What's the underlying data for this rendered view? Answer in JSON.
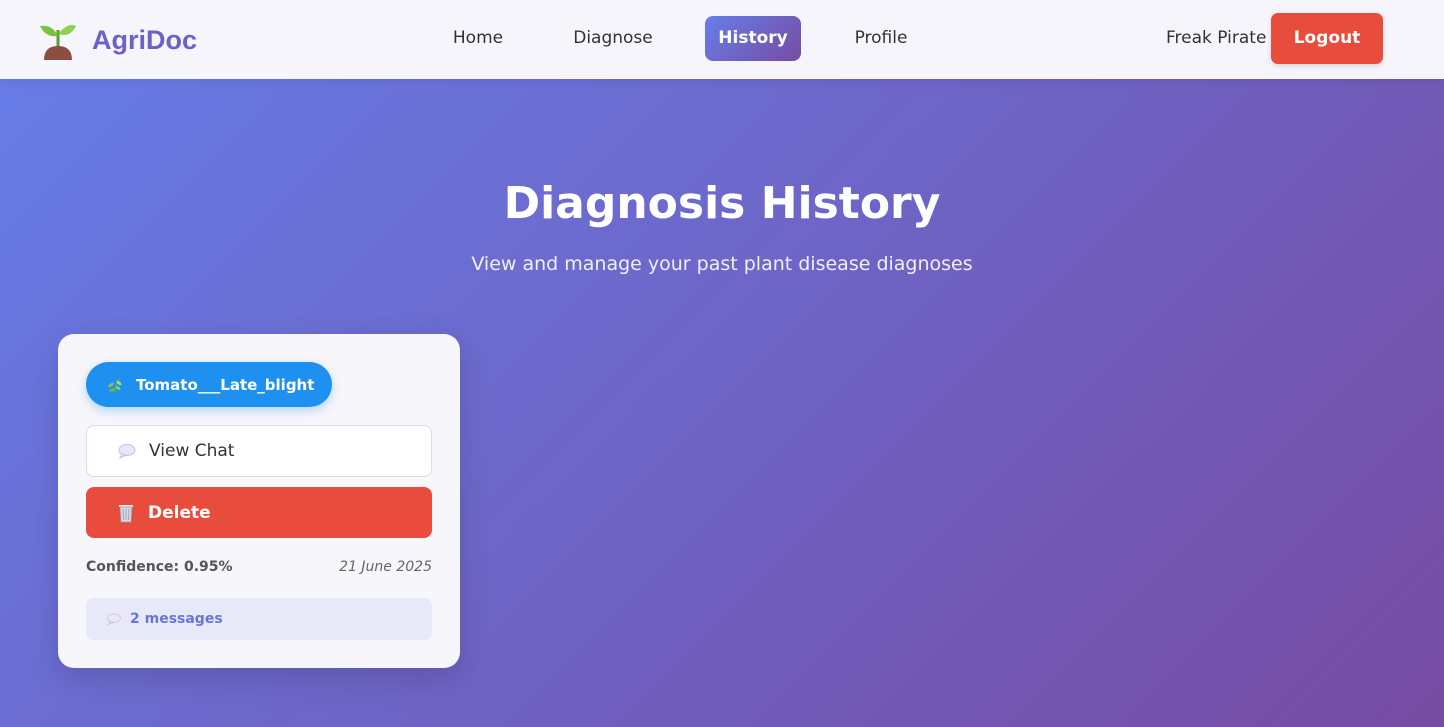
{
  "app": {
    "name": "AgriDoc",
    "logo_icon": "seedling-icon"
  },
  "nav": {
    "items": [
      {
        "label": "Home",
        "active": false
      },
      {
        "label": "Diagnose",
        "active": false
      },
      {
        "label": "History",
        "active": true
      },
      {
        "label": "Profile",
        "active": false
      }
    ],
    "username": "Freak Pirate",
    "logout_label": "Logout"
  },
  "hero": {
    "title": "Diagnosis History",
    "subtitle": "View and manage your past plant disease diagnoses"
  },
  "diagnoses": [
    {
      "disease": "Tomato___Late_blight",
      "disease_icon": "herb-icon",
      "view_chat_label": "View Chat",
      "view_chat_icon": "speech-bubble-icon",
      "delete_label": "Delete",
      "delete_icon": "wastebasket-icon",
      "confidence_text": "Confidence: 0.95%",
      "date": "21 June 2025",
      "messages_text": "2 messages",
      "messages_icon": "speech-bubble-icon"
    }
  ],
  "colors": {
    "primary_gradient_start": "#667eea",
    "primary_gradient_end": "#764ba2",
    "logout": "#e74c3c",
    "delete": "#e74c3c",
    "disease_pill": "#1e90f0",
    "logo_text": "#6a61c9"
  }
}
